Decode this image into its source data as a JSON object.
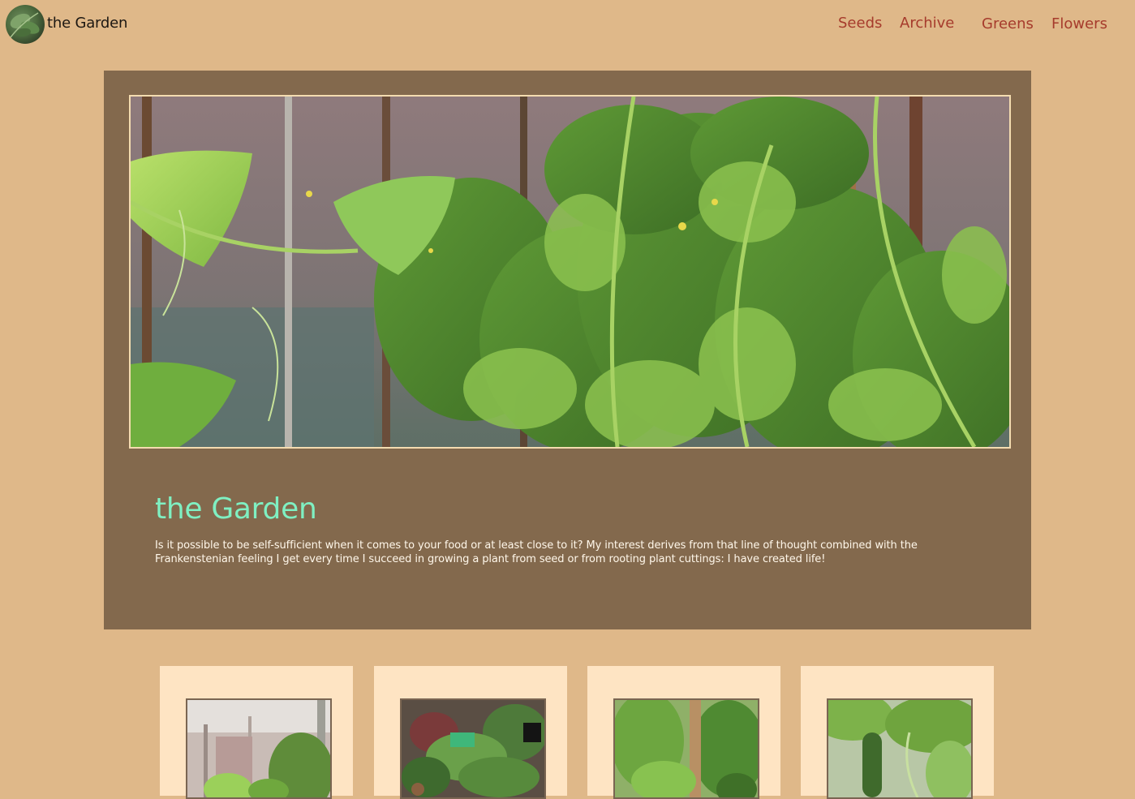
{
  "header": {
    "site_title": "the Garden",
    "logo_alt": "garden-logo"
  },
  "nav": {
    "items": [
      {
        "label": "Seeds"
      },
      {
        "label": "Archive"
      },
      {
        "label": "Greens"
      },
      {
        "label": "Flowers"
      }
    ]
  },
  "hero": {
    "image": "greenhouse-tomato-and-cucumber-plants",
    "title": "the Garden",
    "text": "Is it possible to be self-sufficient when it comes to your food or at least close to it? My interest derives from that line of thought combined with the Frankenstenian feeling I get every time I succeed in growing a plant from seed or from rooting plant cuttings: I have created life!"
  },
  "cards": [
    {
      "image": "greenhouse-interior"
    },
    {
      "image": "seedlings-on-shelves"
    },
    {
      "image": "tomato-plant-with-stake"
    },
    {
      "image": "cucumber-on-vine"
    }
  ],
  "colors": {
    "page_background": "#dfb889",
    "hero_background": "#83694d",
    "hero_title": "#7ff0c2",
    "nav_link": "#a63b2c",
    "card_background": "#fee4c3"
  }
}
